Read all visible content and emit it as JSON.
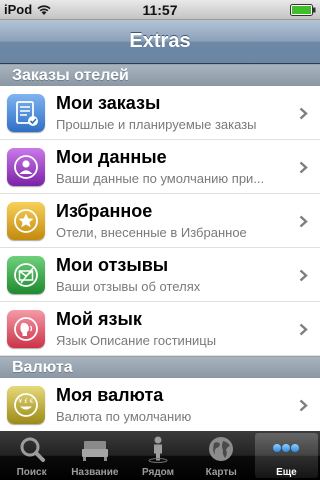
{
  "status_bar": {
    "carrier": "iPod",
    "time": "11:57"
  },
  "nav": {
    "title": "Extras"
  },
  "sections": [
    {
      "header": "Заказы отелей",
      "rows": [
        {
          "title": "Мои заказы",
          "subtitle": "Прошлые и планируемые заказы",
          "icon": "bookings-icon",
          "color": "#3f7fd0"
        },
        {
          "title": "Мои данные",
          "subtitle": "Ваши данные по умолчанию при...",
          "icon": "user-profile-icon",
          "color": "#9b3fc4"
        },
        {
          "title": "Избранное",
          "subtitle": "Отели, внесенные в Избранное",
          "icon": "star-icon",
          "color": "#d7a21d"
        },
        {
          "title": "Мои отзывы",
          "subtitle": "Ваши отзывы об отелях",
          "icon": "reviews-icon",
          "color": "#37a544"
        },
        {
          "title": "Мой язык",
          "subtitle": "Язык Описание гостиницы",
          "icon": "language-icon",
          "color": "#e0576b"
        }
      ]
    },
    {
      "header": "Валюта",
      "rows": [
        {
          "title": "Моя валюта",
          "subtitle": "Валюта по умолчанию",
          "icon": "currency-icon",
          "color": "#c5b12a"
        }
      ]
    }
  ],
  "tabs": [
    {
      "label": "Поиск",
      "icon": "search-icon",
      "active": false
    },
    {
      "label": "Название",
      "icon": "hotel-bed-icon",
      "active": false
    },
    {
      "label": "Рядом",
      "icon": "person-nearby-icon",
      "active": false
    },
    {
      "label": "Карты",
      "icon": "globe-icon",
      "active": false
    },
    {
      "label": "Еще",
      "icon": "more-dots-icon",
      "active": true
    }
  ]
}
